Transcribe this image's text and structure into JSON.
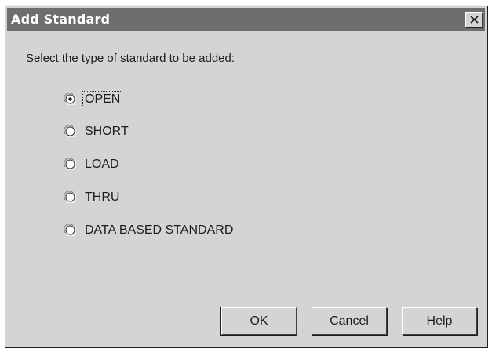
{
  "window": {
    "title": "Add Standard",
    "close_icon": "close-icon",
    "colors": {
      "face": "#d4d4d4",
      "titlebar": "#6e6e6e",
      "title_text": "#ffffff"
    }
  },
  "prompt": "Select the type of standard to be added:",
  "options": [
    {
      "label": "OPEN",
      "selected": true
    },
    {
      "label": "SHORT",
      "selected": false
    },
    {
      "label": "LOAD",
      "selected": false
    },
    {
      "label": "THRU",
      "selected": false
    },
    {
      "label": "DATA BASED STANDARD",
      "selected": false
    }
  ],
  "buttons": {
    "ok": "OK",
    "cancel": "Cancel",
    "help": "Help"
  }
}
